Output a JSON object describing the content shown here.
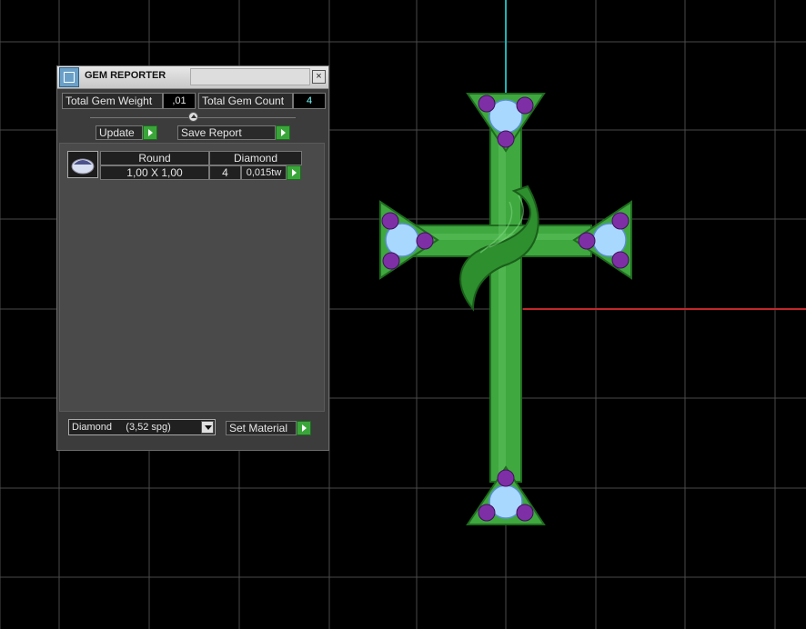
{
  "colors": {
    "grid": "#4a4a4a",
    "axis_y": "#1fb3b3",
    "axis_x": "#c0282b",
    "metal": "#3fa83f",
    "metal_dark": "#1f6b1f",
    "gem_outer": "#7e2fa6",
    "gem_center": "#a9d8ff"
  },
  "panel": {
    "title": "GEM REPORTER",
    "close_glyph": "×",
    "total_weight_label": "Total Gem Weight",
    "total_weight_value": ",01",
    "total_count_label": "Total Gem Count",
    "total_count_value": "4",
    "update_label": "Update",
    "save_report_label": "Save Report",
    "table": {
      "headers": [
        "Round",
        "Diamond"
      ],
      "rows": [
        {
          "size": "1,00 X 1,00",
          "count": "4",
          "weight": "0,015tw"
        }
      ]
    },
    "material_select": {
      "selected": "Diamond     (3,52 spg)"
    },
    "set_material_label": "Set Material"
  }
}
